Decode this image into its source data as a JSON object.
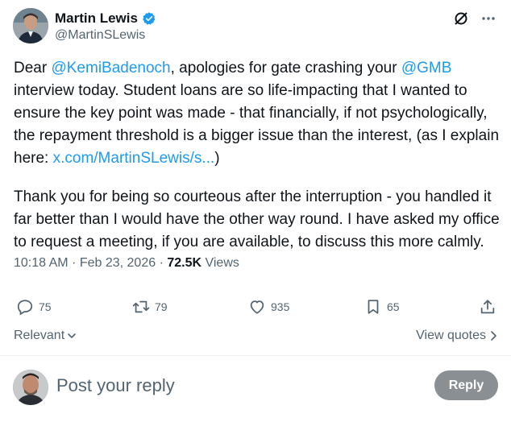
{
  "author": {
    "name": "Martin Lewis",
    "handle": "@MartinSLewis"
  },
  "tweet": {
    "p1_1": "Dear ",
    "mention1": "@KemiBadenoch",
    "p1_2": ", apologies for gate crashing your ",
    "mention2": "@GMB",
    "p1_3": " interview today. Student loans are so life-impacting that I wanted to ensure the key point was made - that financially, if not psychologically, the repayment threshold is a bigger issue than the interest, (as I explain here: ",
    "link": "x.com/MartinSLewis/s...",
    "p1_4": ")",
    "p2": "Thank you for being so courteous after the interruption - you handled it far better than I would have the other way round. I have asked my office to request a meeting, if you are available, to discuss this more calmly."
  },
  "meta": {
    "time": "10:18 AM",
    "sep1": " · ",
    "date": "Feb 23, 2026",
    "sep2": " · ",
    "views_count": "72.5K",
    "views_label": " Views"
  },
  "actions": {
    "replies": "75",
    "retweets": "79",
    "likes": "935",
    "bookmarks": "65"
  },
  "sort": {
    "label": "Relevant"
  },
  "view_quotes": {
    "label": "View quotes"
  },
  "reply": {
    "placeholder": "Post your reply",
    "button": "Reply"
  },
  "colors": {
    "link": "#1d9bf0",
    "secondary_text": "#536471",
    "reply_button": "#8a8f93"
  }
}
